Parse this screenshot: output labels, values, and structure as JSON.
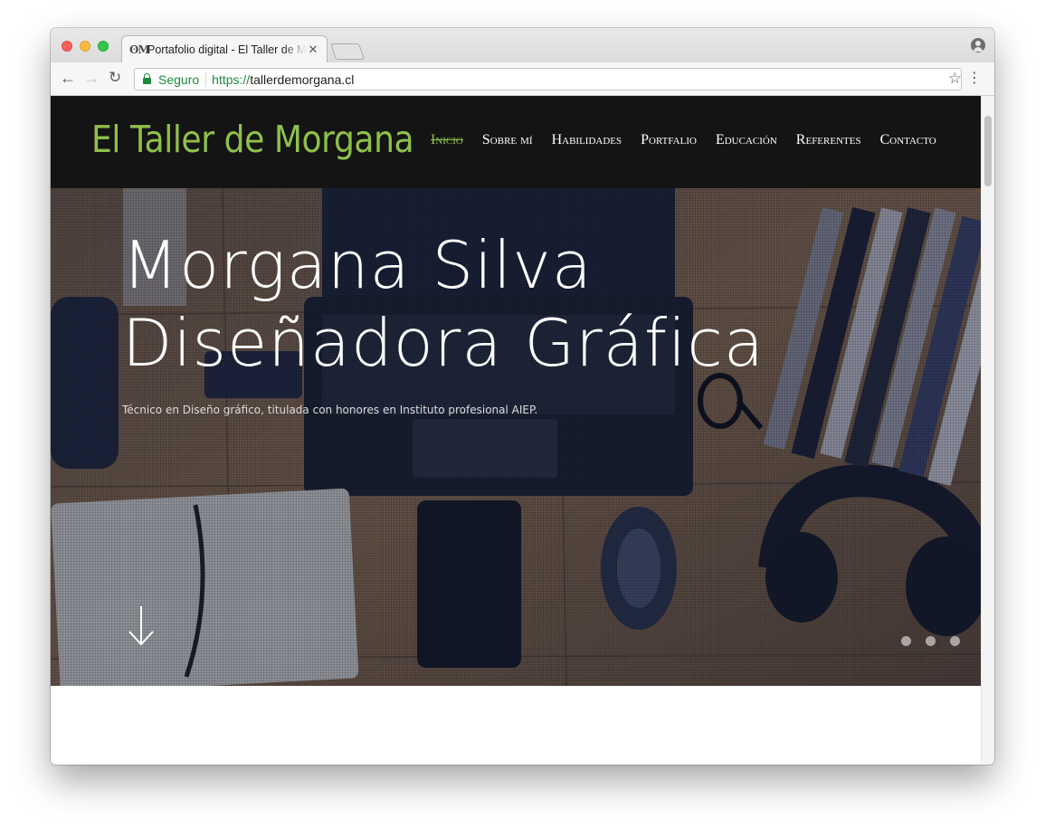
{
  "browser": {
    "tab_title": "Portafolio digital - El Taller de Morgana",
    "tab_favicon": "ʘM",
    "tab_close": "✕",
    "secure_label": "Seguro",
    "url_scheme": "https://",
    "url_host": "tallerdemorgana.cl",
    "back_glyph": "←",
    "forward_glyph": "→",
    "reload_glyph": "↻",
    "star_glyph": "☆",
    "menu_glyph": "⋮"
  },
  "site": {
    "logo": "El Taller de Morgana",
    "nav": [
      {
        "label": "Inicio",
        "active": true
      },
      {
        "label": "Sobre mí",
        "active": false
      },
      {
        "label": "Habilidades",
        "active": false
      },
      {
        "label": "Portfalio",
        "active": false
      },
      {
        "label": "Educación",
        "active": false
      },
      {
        "label": "Referentes",
        "active": false
      },
      {
        "label": "Contacto",
        "active": false
      }
    ]
  },
  "hero": {
    "title_line1": "Morgana Silva",
    "title_line2": "Diseñadora Gráfica",
    "subtitle": "Técnico en Diseño gráfico, titulada con honores en Instituto profesional AIEP.",
    "slides_count": 3
  },
  "colors": {
    "accent": "#8fc04a",
    "header_bg": "#141414",
    "secure_green": "#1a8a3a"
  },
  "icons": {
    "down_arrow": "arrow-down-icon",
    "star": "bookmark-star-icon",
    "lock": "lock-icon"
  }
}
